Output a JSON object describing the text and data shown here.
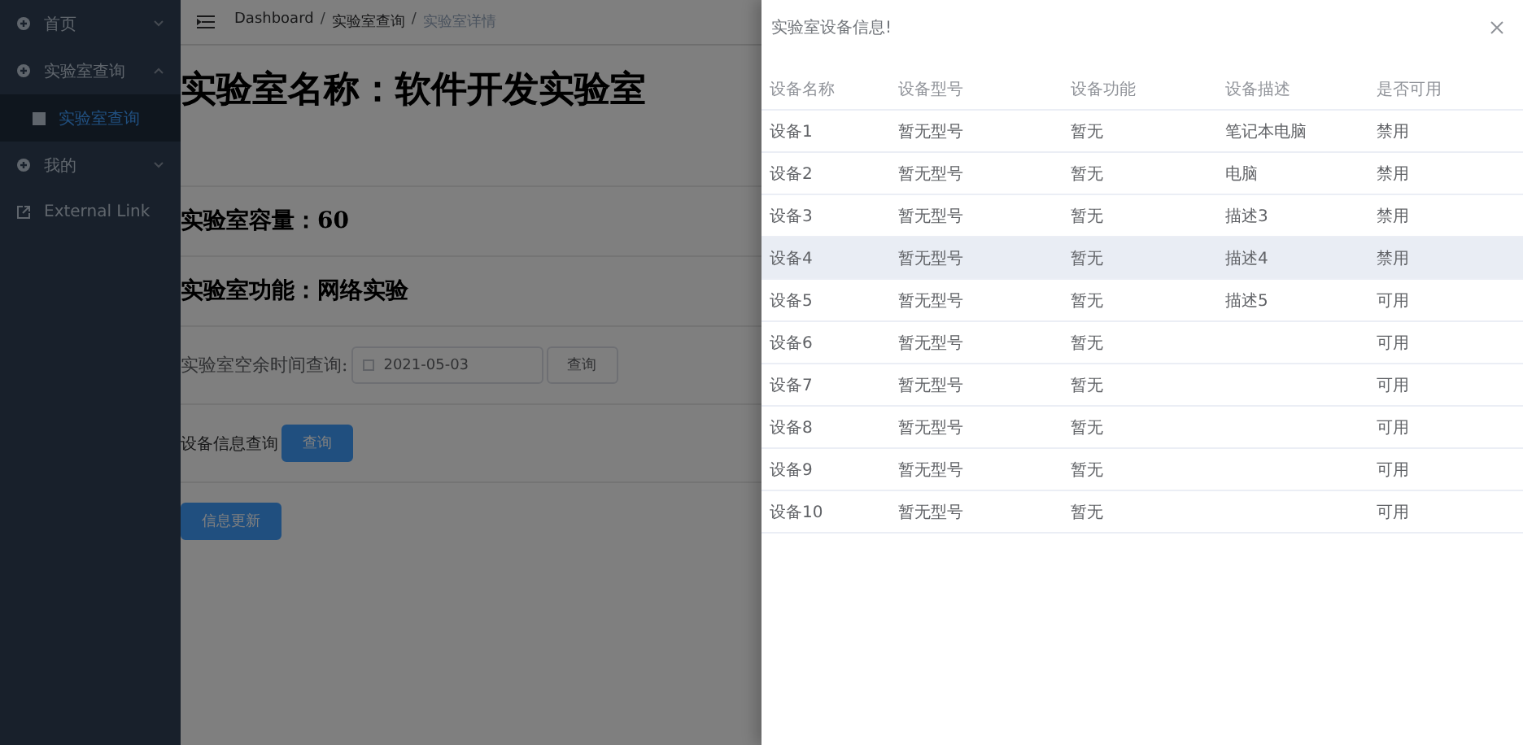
{
  "sidebar": {
    "items": [
      {
        "label": "首页",
        "kind": "menu",
        "expanded": false
      },
      {
        "label": "实验室查询",
        "kind": "menu",
        "expanded": true,
        "children": [
          {
            "label": "实验室查询",
            "selected": true
          }
        ]
      },
      {
        "label": "我的",
        "kind": "menu",
        "expanded": false
      },
      {
        "label": "External Link",
        "kind": "link"
      }
    ]
  },
  "breadcrumb_separator": "/",
  "breadcrumb": [
    {
      "label": "Dashboard",
      "current": false
    },
    {
      "label": "实验室查询",
      "current": false
    },
    {
      "label": "实验室详情",
      "current": true
    }
  ],
  "lab": {
    "name": "实验室名称：软件开发实验室",
    "capacity": "实验室容量：60",
    "function": "实验室功能：网络实验"
  },
  "time_query": {
    "label": "实验室空余时间查询:",
    "date": "2021-05-03",
    "button": "查询"
  },
  "device_query": {
    "label": "设备信息查询",
    "button": "查询"
  },
  "update_button": "信息更新",
  "drawer": {
    "title": "实验室设备信息!",
    "table": {
      "columns": [
        "设备名称",
        "设备型号",
        "设备功能",
        "设备描述",
        "是否可用"
      ],
      "rows": [
        {
          "cells": [
            "设备1",
            "暂无型号",
            "暂无",
            "笔记本电脑",
            "禁用"
          ],
          "highlighted": false
        },
        {
          "cells": [
            "设备2",
            "暂无型号",
            "暂无",
            "电脑",
            "禁用"
          ],
          "highlighted": false
        },
        {
          "cells": [
            "设备3",
            "暂无型号",
            "暂无",
            "描述3",
            "禁用"
          ],
          "highlighted": false
        },
        {
          "cells": [
            "设备4",
            "暂无型号",
            "暂无",
            "描述4",
            "禁用"
          ],
          "highlighted": true
        },
        {
          "cells": [
            "设备5",
            "暂无型号",
            "暂无",
            "描述5",
            "可用"
          ],
          "highlighted": false
        },
        {
          "cells": [
            "设备6",
            "暂无型号",
            "暂无",
            "",
            "可用"
          ],
          "highlighted": false
        },
        {
          "cells": [
            "设备7",
            "暂无型号",
            "暂无",
            "",
            "可用"
          ],
          "highlighted": false
        },
        {
          "cells": [
            "设备8",
            "暂无型号",
            "暂无",
            "",
            "可用"
          ],
          "highlighted": false
        },
        {
          "cells": [
            "设备9",
            "暂无型号",
            "暂无",
            "",
            "可用"
          ],
          "highlighted": false
        },
        {
          "cells": [
            "设备10",
            "暂无型号",
            "暂无",
            "",
            "可用"
          ],
          "highlighted": false
        }
      ]
    }
  }
}
